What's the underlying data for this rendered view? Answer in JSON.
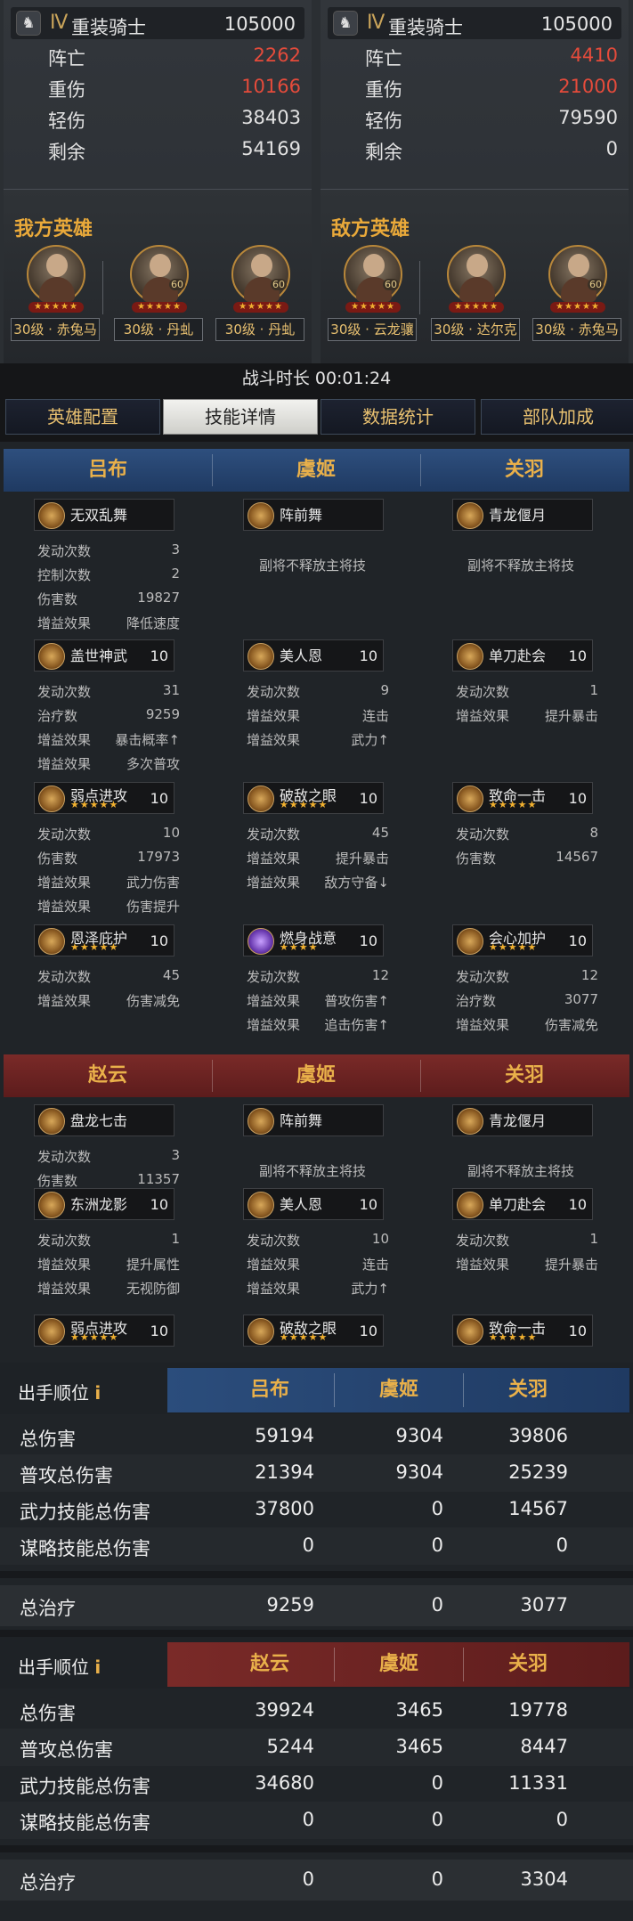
{
  "left_panel": {
    "unit": {
      "icon": "horse-icon",
      "rank": "Ⅳ",
      "name": "重装骑士",
      "count": "105000"
    },
    "stats": [
      {
        "label": "阵亡",
        "value": "2262",
        "color": "red"
      },
      {
        "label": "重伤",
        "value": "10166",
        "color": "red"
      },
      {
        "label": "轻伤",
        "value": "38403",
        "color": "white"
      },
      {
        "label": "剩余",
        "value": "54169",
        "color": "white"
      }
    ],
    "heroes_title": "我方英雄",
    "heroes": [
      {
        "label": "30级 · 赤兔马",
        "badge": "",
        "stars": "★★★★★"
      },
      {
        "label": "30级 · 丹虬",
        "badge": "60",
        "stars": "★★★★★"
      },
      {
        "label": "30级 · 丹虬",
        "badge": "60",
        "stars": "★★★★★"
      }
    ]
  },
  "right_panel": {
    "unit": {
      "icon": "horse-icon",
      "rank": "Ⅳ",
      "name": "重装骑士",
      "count": "105000"
    },
    "stats": [
      {
        "label": "阵亡",
        "value": "4410",
        "color": "red"
      },
      {
        "label": "重伤",
        "value": "21000",
        "color": "red"
      },
      {
        "label": "轻伤",
        "value": "79590",
        "color": "white"
      },
      {
        "label": "剩余",
        "value": "0",
        "color": "white"
      }
    ],
    "heroes_title": "敌方英雄",
    "heroes": [
      {
        "label": "30级 · 云龙骧",
        "badge": "60",
        "stars": "★★★★★"
      },
      {
        "label": "30级 · 达尔克",
        "badge": "",
        "stars": "★★★★★"
      },
      {
        "label": "30级 · 赤兔马",
        "badge": "60",
        "stars": "★★★★★"
      }
    ]
  },
  "battle_time": "战斗时长 00:01:24",
  "tabs": [
    "英雄配置",
    "技能详情",
    "数据统计",
    "部队加成"
  ],
  "active_tab": 1,
  "skills_blue": {
    "heroes": [
      "吕布",
      "虞姬",
      "关羽"
    ],
    "no_skill_note": "副将不释放主将技",
    "blocks": [
      [
        {
          "name": "无双乱舞",
          "level": "",
          "stars": "",
          "stats": [
            [
              "发动次数",
              "3"
            ],
            [
              "控制次数",
              "2"
            ],
            [
              "伤害数",
              "19827"
            ],
            [
              "增益效果",
              "降低速度"
            ]
          ]
        },
        {
          "name": "阵前舞",
          "level": "",
          "stars": "",
          "note": true,
          "stats": []
        },
        {
          "name": "青龙偃月",
          "level": "",
          "stars": "",
          "note": true,
          "stats": []
        }
      ],
      [
        {
          "name": "盖世神武",
          "level": "10",
          "stars": "",
          "stats": [
            [
              "发动次数",
              "31"
            ],
            [
              "治疗数",
              "9259"
            ],
            [
              "增益效果",
              "暴击概率↑"
            ],
            [
              "增益效果",
              "多次普攻"
            ]
          ]
        },
        {
          "name": "美人恩",
          "level": "10",
          "stars": "",
          "stats": [
            [
              "发动次数",
              "9"
            ],
            [
              "增益效果",
              "连击"
            ],
            [
              "增益效果",
              "武力↑"
            ]
          ]
        },
        {
          "name": "单刀赴会",
          "level": "10",
          "stars": "",
          "stats": [
            [
              "发动次数",
              "1"
            ],
            [
              "增益效果",
              "提升暴击"
            ]
          ]
        }
      ],
      [
        {
          "name": "弱点进攻",
          "level": "10",
          "stars": "★★★★★",
          "stats": [
            [
              "发动次数",
              "10"
            ],
            [
              "伤害数",
              "17973"
            ],
            [
              "增益效果",
              "武力伤害"
            ],
            [
              "增益效果",
              "伤害提升"
            ]
          ]
        },
        {
          "name": "破敌之眼",
          "level": "10",
          "stars": "★★★★★",
          "stats": [
            [
              "发动次数",
              "45"
            ],
            [
              "增益效果",
              "提升暴击"
            ],
            [
              "增益效果",
              "敌方守备↓"
            ]
          ]
        },
        {
          "name": "致命一击",
          "level": "10",
          "stars": "★★★★★",
          "stats": [
            [
              "发动次数",
              "8"
            ],
            [
              "伤害数",
              "14567"
            ]
          ]
        }
      ],
      [
        {
          "name": "恩泽庇护",
          "level": "10",
          "stars": "★★★★★",
          "stats": [
            [
              "发动次数",
              "45"
            ],
            [
              "增益效果",
              "伤害减免"
            ]
          ]
        },
        {
          "name": "燃身战意",
          "level": "10",
          "stars": "★★★★",
          "purple": true,
          "stats": [
            [
              "发动次数",
              "12"
            ],
            [
              "增益效果",
              "普攻伤害↑"
            ],
            [
              "增益效果",
              "追击伤害↑"
            ]
          ]
        },
        {
          "name": "会心加护",
          "level": "10",
          "stars": "★★★★★",
          "stats": [
            [
              "发动次数",
              "12"
            ],
            [
              "治疗数",
              "3077"
            ],
            [
              "增益效果",
              "伤害减免"
            ]
          ]
        }
      ]
    ]
  },
  "skills_red": {
    "heroes": [
      "赵云",
      "虞姬",
      "关羽"
    ],
    "no_skill_note": "副将不释放主将技",
    "blocks": [
      [
        {
          "name": "盘龙七击",
          "level": "",
          "stars": "",
          "stats": [
            [
              "发动次数",
              "3"
            ],
            [
              "伤害数",
              "11357"
            ]
          ]
        },
        {
          "name": "阵前舞",
          "level": "",
          "stars": "",
          "note": true,
          "stats": []
        },
        {
          "name": "青龙偃月",
          "level": "",
          "stars": "",
          "note": true,
          "stats": []
        }
      ],
      [
        {
          "name": "东洲龙影",
          "level": "10",
          "stars": "",
          "stats": [
            [
              "发动次数",
              "1"
            ],
            [
              "增益效果",
              "提升属性"
            ],
            [
              "增益效果",
              "无视防御"
            ]
          ]
        },
        {
          "name": "美人恩",
          "level": "10",
          "stars": "",
          "stats": [
            [
              "发动次数",
              "10"
            ],
            [
              "增益效果",
              "连击"
            ],
            [
              "增益效果",
              "武力↑"
            ]
          ]
        },
        {
          "name": "单刀赴会",
          "level": "10",
          "stars": "",
          "stats": [
            [
              "发动次数",
              "1"
            ],
            [
              "增益效果",
              "提升暴击"
            ]
          ]
        }
      ],
      [
        {
          "name": "弱点进攻",
          "level": "10",
          "stars": "★★★★★",
          "stats": []
        },
        {
          "name": "破敌之眼",
          "level": "10",
          "stars": "★★★★★",
          "stats": []
        },
        {
          "name": "致命一击",
          "level": "10",
          "stars": "★★★★★",
          "stats": []
        }
      ]
    ]
  },
  "table_blue": {
    "header_label": "出手顺位",
    "info_glyph": "i",
    "heroes": [
      "吕布",
      "虞姬",
      "关羽"
    ],
    "rows": [
      {
        "label": "总伤害",
        "values": [
          "59194",
          "9304",
          "39806"
        ]
      },
      {
        "label": "普攻总伤害",
        "values": [
          "21394",
          "9304",
          "25239"
        ]
      },
      {
        "label": "武力技能总伤害",
        "values": [
          "37800",
          "0",
          "14567"
        ]
      },
      {
        "label": "谋略技能总伤害",
        "values": [
          "0",
          "0",
          "0"
        ]
      }
    ],
    "heal": {
      "label": "总治疗",
      "values": [
        "9259",
        "0",
        "3077"
      ]
    }
  },
  "table_red": {
    "header_label": "出手顺位",
    "info_glyph": "i",
    "heroes": [
      "赵云",
      "虞姬",
      "关羽"
    ],
    "rows": [
      {
        "label": "总伤害",
        "values": [
          "39924",
          "3465",
          "19778"
        ]
      },
      {
        "label": "普攻总伤害",
        "values": [
          "5244",
          "3465",
          "8447"
        ]
      },
      {
        "label": "武力技能总伤害",
        "values": [
          "34680",
          "0",
          "11331"
        ]
      },
      {
        "label": "谋略技能总伤害",
        "values": [
          "0",
          "0",
          "0"
        ]
      }
    ],
    "heal": {
      "label": "总治疗",
      "values": [
        "0",
        "0",
        "3304"
      ]
    }
  }
}
